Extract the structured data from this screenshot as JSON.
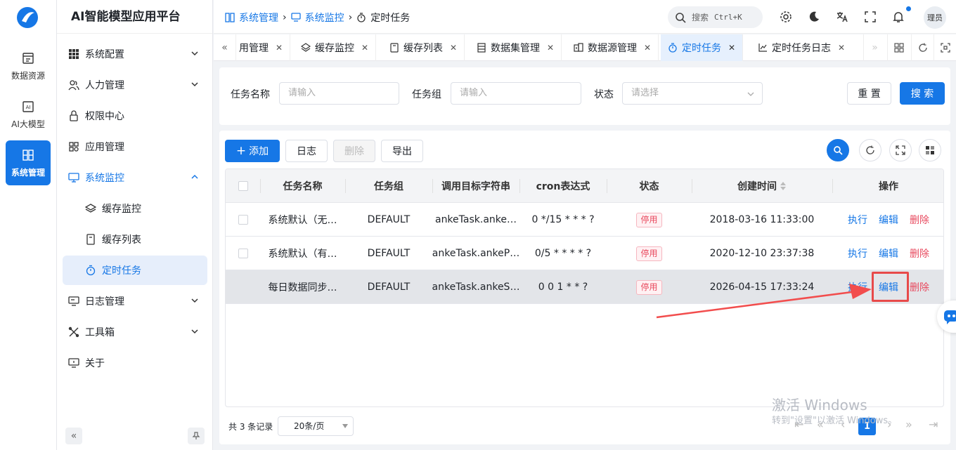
{
  "rail": {
    "items": [
      {
        "label": "数据资源",
        "icon": "data-resource-icon"
      },
      {
        "label": "AI大模型",
        "icon": "ai-model-icon"
      },
      {
        "label": "系统管理",
        "icon": "system-manage-icon"
      }
    ]
  },
  "menu": {
    "title": "AI智能模型应用平台",
    "items": [
      {
        "label": "系统配置"
      },
      {
        "label": "人力管理"
      },
      {
        "label": "权限中心"
      },
      {
        "label": "应用管理"
      },
      {
        "label": "系统监控"
      },
      {
        "label": "缓存监控"
      },
      {
        "label": "缓存列表"
      },
      {
        "label": "定时任务"
      },
      {
        "label": "日志管理"
      },
      {
        "label": "工具箱"
      },
      {
        "label": "关于"
      }
    ]
  },
  "breadcrumb": [
    "系统管理",
    "系统监控",
    "定时任务"
  ],
  "header": {
    "search_placeholder": "搜索",
    "shortcut": "Ctrl+K",
    "user": "理员"
  },
  "tabs": [
    {
      "label": "用管理"
    },
    {
      "label": "缓存监控"
    },
    {
      "label": "缓存列表"
    },
    {
      "label": "数据集管理"
    },
    {
      "label": "数据源管理"
    },
    {
      "label": "定时任务"
    },
    {
      "label": "定时任务日志"
    }
  ],
  "filters": {
    "task_name_label": "任务名称",
    "task_name_placeholder": "请输入",
    "task_group_label": "任务组",
    "task_group_placeholder": "请输入",
    "status_label": "状态",
    "status_placeholder": "请选择",
    "reset": "重 置",
    "search": "搜 索"
  },
  "toolbar": {
    "add": "添加",
    "log": "日志",
    "delete": "删除",
    "export": "导出"
  },
  "table": {
    "columns": [
      "任务名称",
      "任务组",
      "调用目标字符串",
      "cron表达式",
      "状态",
      "创建时间",
      "操作"
    ],
    "rows": [
      {
        "name": "系统默认（无…",
        "group": "DEFAULT",
        "target": "ankeTask.anke…",
        "cron": "0 */15 * * * ?",
        "status": "停用",
        "created": "2018-03-16 11:33:00"
      },
      {
        "name": "系统默认（有…",
        "group": "DEFAULT",
        "target": "ankeTask.ankeP…",
        "cron": "0/5 * * * * ?",
        "status": "停用",
        "created": "2020-12-10 23:37:38"
      },
      {
        "name": "每日数据同步…",
        "group": "DEFAULT",
        "target": "ankeTask.ankeS…",
        "cron": "0 0 1 * * ?",
        "status": "停用",
        "created": "2026-04-15 17:33:24"
      }
    ],
    "actions": {
      "run": "执行",
      "edit": "编辑",
      "delete": "删除"
    }
  },
  "pager": {
    "total": "共 3 条记录",
    "page_size": "20条/页",
    "current": "1"
  },
  "watermark": {
    "line1": "激活 Windows",
    "line2": "转到\"设置\"以激活 Windows。"
  },
  "colors": {
    "accent": "#1677e6",
    "danger": "#e84a5f"
  }
}
